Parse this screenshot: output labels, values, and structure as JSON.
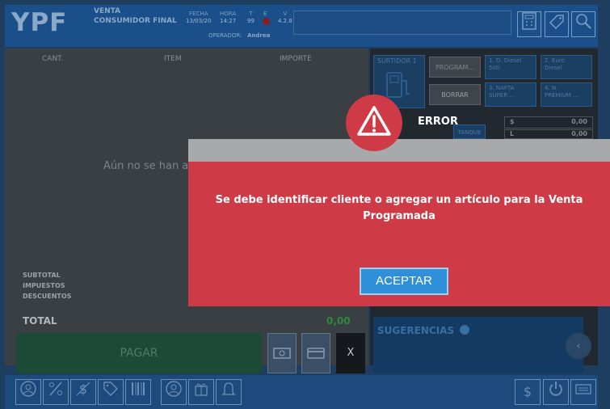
{
  "header": {
    "logo": "YPF",
    "venta_line1": "VENTA",
    "venta_line2": "CONSUMIDOR FINAL",
    "fecha_label": "FECHA",
    "fecha_value": "13/03/20",
    "hora_label": "HORA",
    "hora_value": "14:27",
    "t_label": "T",
    "t_value": "99",
    "e_label": "E",
    "v_label": "V",
    "v_value": "4.2.8",
    "operador_label": "OPERADOR:",
    "operador_value": "Andrea",
    "icons": [
      "calculator-icon",
      "tag-edit-icon",
      "search-icon"
    ]
  },
  "ticket": {
    "col_cant": "CANT.",
    "col_item": "ITEM",
    "col_importe": "IMPORTE",
    "empty_text": "Aún no se han a",
    "subtotal_label": "SUBTOTAL",
    "impuestos_label": "IMPUESTOS",
    "descuentos_label": "DESCUENTOS",
    "total_label": "TOTAL",
    "total_value": "0,00",
    "pagar_label": "PAGAR",
    "x_label": "X"
  },
  "surtidor": {
    "title": "SURTIDOR 1",
    "program_label": "PROGRAM...",
    "borrar_label": "BORRAR",
    "tanque_label": "TANQUE",
    "products": [
      {
        "line1": "1. D. Diesel",
        "line2": "500"
      },
      {
        "line1": "2. Euro",
        "line2": "Diesel"
      },
      {
        "line1": "3. NAFTA",
        "line2": "SUPER ..."
      },
      {
        "line1": "4. N.",
        "line2": "PREMIUM ..."
      }
    ],
    "money_symbol": "$",
    "money_value": "0,00",
    "liters_symbol": "L",
    "liters_value": "0,00"
  },
  "sugerencias": {
    "label": "SUGERENCIAS"
  },
  "bottombar": {
    "icons": [
      "user-icon",
      "percent-icon",
      "dollar-icon",
      "tag-icon",
      "barcode-icon",
      "user-settings-icon",
      "gift-icon",
      "bell-icon"
    ],
    "right_icons": [
      "dollar-icon",
      "power-icon",
      "keyboard-icon"
    ],
    "dollar_glyph": "$"
  },
  "dialog": {
    "title": "ERROR",
    "message_line1": "Se debe identificar cliente o agregar un artículo para la Venta",
    "message_line2": "Programada",
    "button_label": "ACEPTAR",
    "colors": {
      "panel": "#cf3a47",
      "button": "#2f8fd8"
    }
  }
}
